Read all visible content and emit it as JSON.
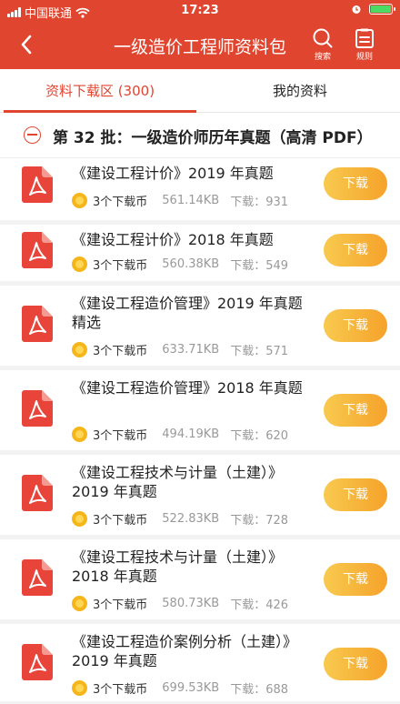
{
  "status_bar": {
    "carrier": "中国联通",
    "time": "17:23"
  },
  "nav": {
    "title": "一级造价工程师资料包",
    "search_label": "搜索",
    "rules_label": "规则"
  },
  "tabs": [
    {
      "label": "资料下载区 (300)",
      "active": true
    },
    {
      "label": "我的资料",
      "active": false
    }
  ],
  "batch": {
    "title": "第 32 批：一级造价师历年真题（高清 PDF）"
  },
  "download_label": "下载",
  "items": [
    {
      "title": "《建设工程计价》2019 年真题",
      "cost": "3个下载币",
      "size": "561.14KB",
      "downloads": "下载：931"
    },
    {
      "title": "《建设工程计价》2018 年真题",
      "cost": "3个下载币",
      "size": "560.38KB",
      "downloads": "下载：549"
    },
    {
      "title": "《建设工程造价管理》2019 年真题精选",
      "cost": "3个下载币",
      "size": "633.71KB",
      "downloads": "下载：571"
    },
    {
      "title": "《建设工程造价管理》2018 年真题",
      "cost": "3个下载币",
      "size": "494.19KB",
      "downloads": "下载：620"
    },
    {
      "title": "《建设工程技术与计量（土建）》2019 年真题",
      "cost": "3个下载币",
      "size": "522.83KB",
      "downloads": "下载：728"
    },
    {
      "title": "《建设工程技术与计量（土建）》2018 年真题",
      "cost": "3个下载币",
      "size": "580.73KB",
      "downloads": "下载：426"
    },
    {
      "title": "《建设工程造价案例分析（土建）》2019 年真题",
      "cost": "3个下载币",
      "size": "699.53KB",
      "downloads": "下载：688"
    }
  ]
}
